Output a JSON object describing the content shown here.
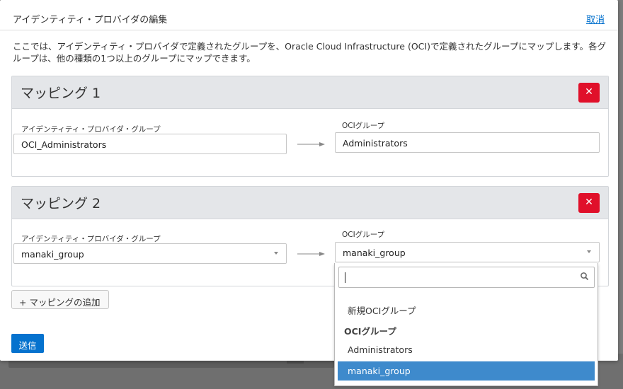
{
  "dialog": {
    "title": "アイデンティティ・プロバイダの編集",
    "cancel_label": "取消",
    "description": "ここでは、アイデンティティ・プロバイダで定義されたグループを、Oracle Cloud Infrastructure (OCI)で定義されたグループにマップします。各グループは、他の種類の1つ以上のグループにマップできます。"
  },
  "mappings": [
    {
      "title": "マッピング 1",
      "idp_label": "アイデンティティ・プロバイダ・グループ",
      "idp_value": "OCI_Administrators",
      "oci_label": "OCIグループ",
      "oci_value": "Administrators",
      "delete_icon": "close-icon"
    },
    {
      "title": "マッピング 2",
      "idp_label": "アイデンティティ・プロバイダ・グループ",
      "idp_value": "manaki_group",
      "oci_label": "OCIグループ",
      "oci_value": "manaki_group",
      "delete_icon": "close-icon"
    }
  ],
  "add_mapping_label": "+ マッピングの追加",
  "submit_label": "送信",
  "dropdown": {
    "search_value": "",
    "search_icon": "search-icon",
    "options": [
      {
        "label": "新規OCIグループ",
        "type": "option"
      },
      {
        "label": "OCIグループ",
        "type": "group"
      },
      {
        "label": "Administrators",
        "type": "option"
      },
      {
        "label": "manaki_group",
        "type": "option",
        "selected": true
      }
    ]
  },
  "colors": {
    "accent": "#0572ce",
    "danger": "#e0102a",
    "selected": "#3e8acc",
    "panel_header": "#e4e6e9"
  }
}
